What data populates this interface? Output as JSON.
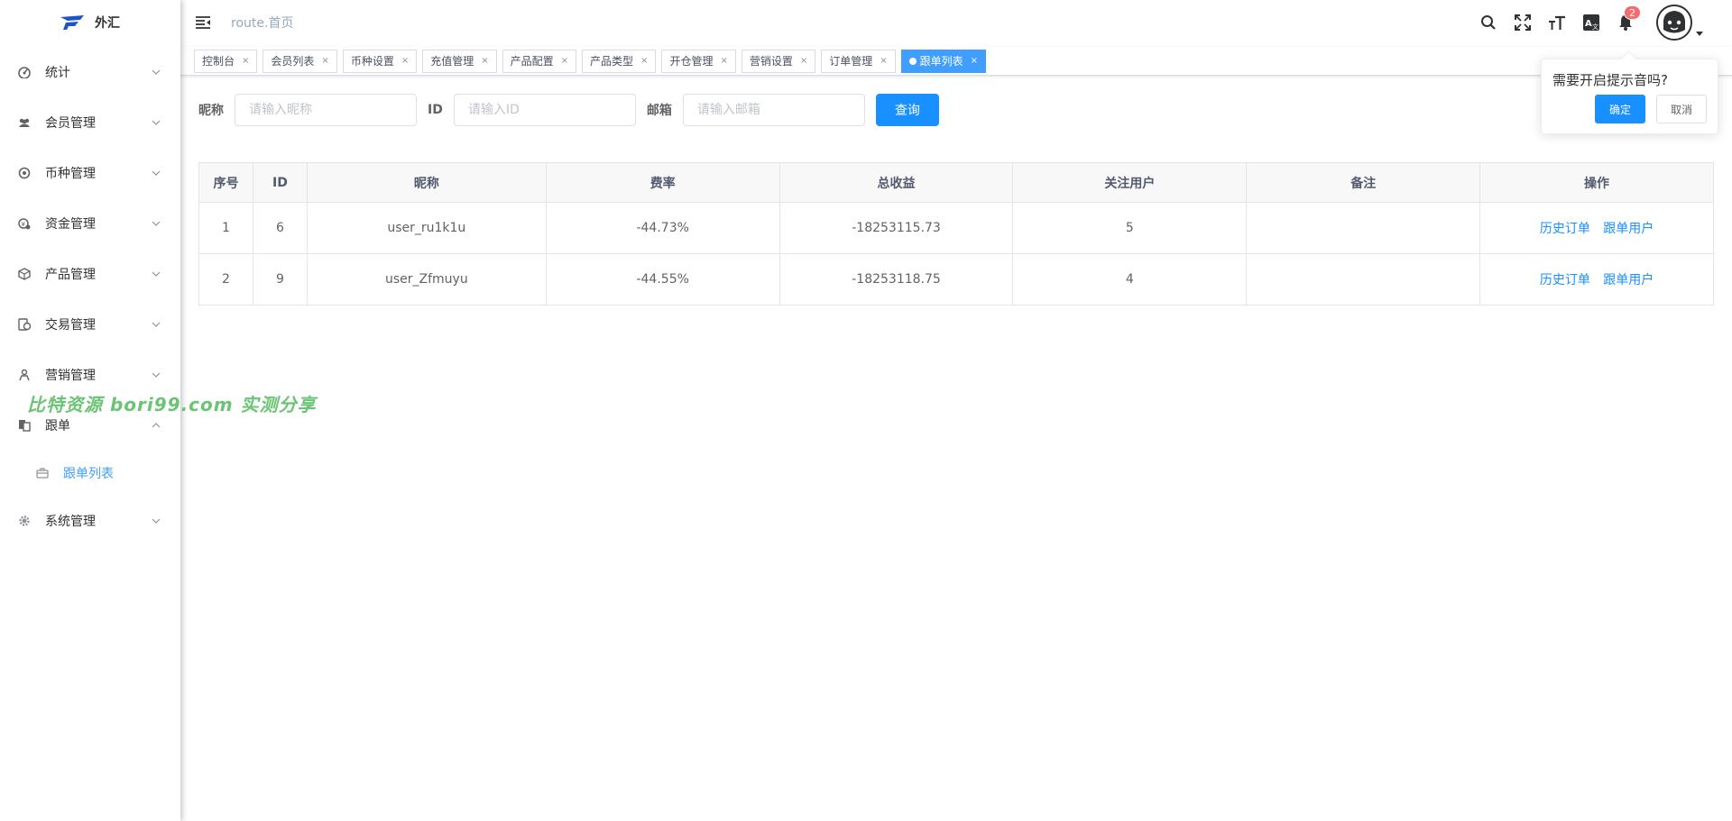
{
  "app": {
    "title": "外汇"
  },
  "sidebar": {
    "items": [
      {
        "label": "统计",
        "icon": "dashboard-icon"
      },
      {
        "label": "会员管理",
        "icon": "users-icon"
      },
      {
        "label": "币种管理",
        "icon": "coin-icon"
      },
      {
        "label": "资金管理",
        "icon": "funds-icon"
      },
      {
        "label": "产品管理",
        "icon": "box-icon"
      },
      {
        "label": "交易管理",
        "icon": "trade-icon"
      },
      {
        "label": "营销管理",
        "icon": "marketing-icon"
      },
      {
        "label": "跟单",
        "icon": "copy-icon",
        "expanded": true
      },
      {
        "label": "系统管理",
        "icon": "gear-icon"
      }
    ],
    "submenu": {
      "label": "跟单列表",
      "active": true
    }
  },
  "watermark": "比特资源 bori99.com 实测分享",
  "header": {
    "breadcrumb": "route.首页",
    "notification_count": "2"
  },
  "tabs": [
    {
      "label": "控制台"
    },
    {
      "label": "会员列表"
    },
    {
      "label": "币种设置"
    },
    {
      "label": "充值管理"
    },
    {
      "label": "产品配置"
    },
    {
      "label": "产品类型"
    },
    {
      "label": "开仓管理"
    },
    {
      "label": "营销设置"
    },
    {
      "label": "订单管理"
    },
    {
      "label": "跟单列表",
      "active": true
    }
  ],
  "search": {
    "nickname_label": "昵称",
    "nickname_placeholder": "请输入昵称",
    "id_label": "ID",
    "id_placeholder": "请输入ID",
    "email_label": "邮箱",
    "email_placeholder": "请输入邮箱",
    "query_button": "查询"
  },
  "table": {
    "columns": [
      "序号",
      "ID",
      "昵称",
      "费率",
      "总收益",
      "关注用户",
      "备注",
      "操作"
    ],
    "rows": [
      {
        "index": "1",
        "id": "6",
        "nickname": "user_ru1k1u",
        "rate": "-44.73%",
        "profit": "-18253115.73",
        "followers": "5",
        "remark": ""
      },
      {
        "index": "2",
        "id": "9",
        "nickname": "user_Zfmuyu",
        "rate": "-44.55%",
        "profit": "-18253118.75",
        "followers": "4",
        "remark": ""
      }
    ],
    "actions": {
      "history": "历史订单",
      "follow_users": "跟单用户"
    }
  },
  "popconfirm": {
    "text": "需要开启提示音吗?",
    "confirm": "确定",
    "cancel": "取消"
  },
  "colors": {
    "primary": "#1890ff",
    "active_tab": "#409eff",
    "danger": "#f56c6c",
    "watermark": "#5fc06a"
  }
}
